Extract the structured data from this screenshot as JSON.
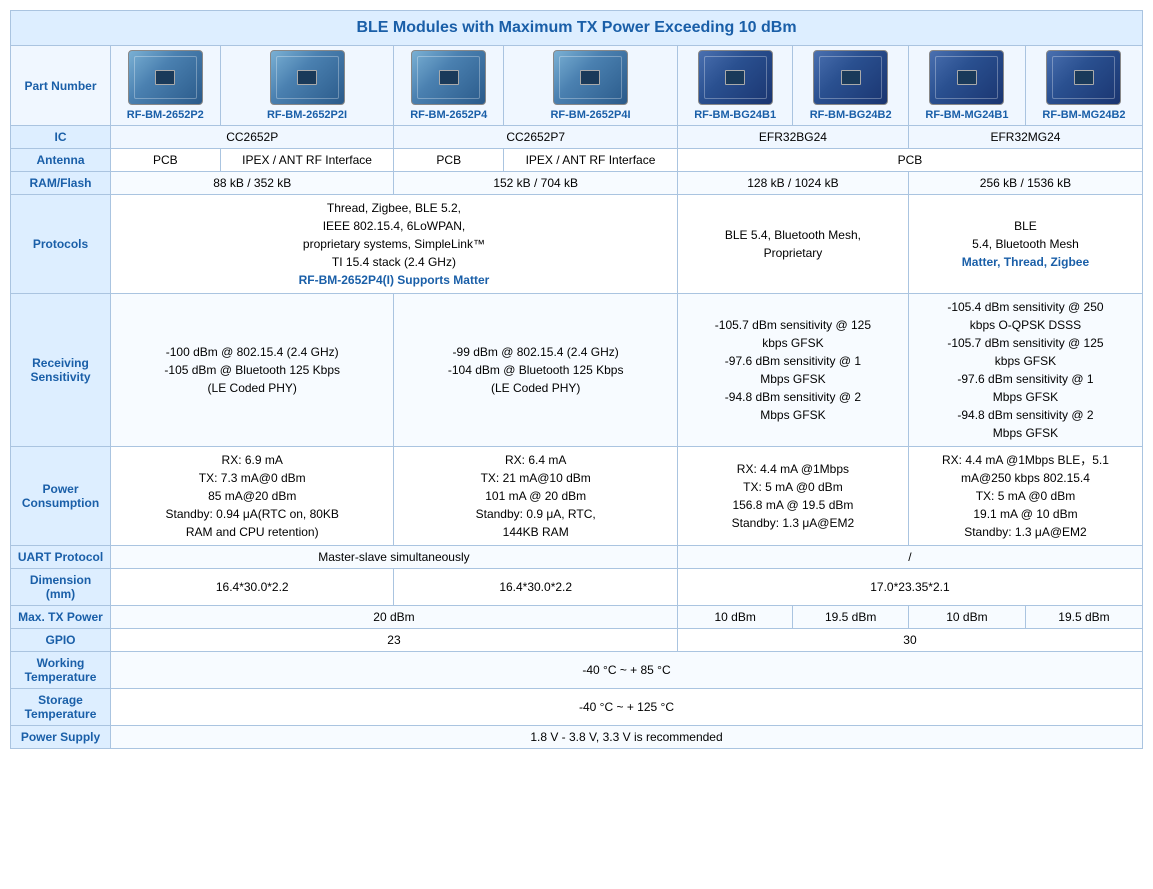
{
  "title": "BLE Modules with Maximum TX Power Exceeding 10 dBm",
  "columns": [
    {
      "id": "col1",
      "part": "RF-BM-2652P2",
      "group": "A"
    },
    {
      "id": "col2",
      "part": "RF-BM-2652P2I",
      "group": "A"
    },
    {
      "id": "col3",
      "part": "RF-BM-2652P4",
      "group": "B"
    },
    {
      "id": "col4",
      "part": "RF-BM-2652P4I",
      "group": "B"
    },
    {
      "id": "col5",
      "part": "RF-BM-BG24B1",
      "group": "C"
    },
    {
      "id": "col6",
      "part": "RF-BM-BG24B2",
      "group": "C"
    },
    {
      "id": "col7",
      "part": "RF-BM-MG24B1",
      "group": "D"
    },
    {
      "id": "col8",
      "part": "RF-BM-MG24B2",
      "group": "D"
    }
  ],
  "rows": {
    "ic": {
      "label": "IC",
      "groupA": "CC2652P",
      "groupB": "CC2652P7",
      "groupC": "EFR32BG24",
      "groupD": "EFR32MG24"
    },
    "antenna": {
      "label": "Antenna",
      "col1": "PCB",
      "col2": "IPEX / ANT RF Interface",
      "col3": "PCB",
      "col4": "IPEX / ANT RF Interface",
      "groupCD": "PCB"
    },
    "ram_flash": {
      "label": "RAM/Flash",
      "groupAB1": "88 kB / 352 kB",
      "groupAB2": "152 kB / 704 kB",
      "groupC": "128 kB / 1024 kB",
      "groupD": "256 kB / 1536 kB"
    },
    "protocols": {
      "label": "Protocols",
      "groupAB": "Thread, Zigbee, BLE 5.2,\nIEEE 802.15.4, 6LoWPAN,\nproprietary systems, SimpleLink™\nTI 15.4 stack (2.4 GHz)",
      "groupAB_bold": "RF-BM-2652P4(I) Supports Matter",
      "groupC": "BLE 5.4, Bluetooth Mesh,\nPropriety",
      "groupD_line1": "BLE",
      "groupD_line2": "5.4, Bluetooth Mesh",
      "groupD_bold": "Matter, Thread, Zigbee"
    },
    "rx_sensitivity": {
      "label": "Receiving\nSensitivity",
      "groupAB1": "-100 dBm @ 802.15.4 (2.4 GHz)\n-105 dBm @ Bluetooth 125 Kbps\n(LE Coded PHY)",
      "groupAB2": "-99 dBm @ 802.15.4 (2.4 GHz)\n-104 dBm @ Bluetooth 125 Kbps\n(LE Coded PHY)",
      "groupC": "-105.7 dBm sensitivity @ 125 kbps GFSK\n-97.6 dBm sensitivity @ 1 Mbps GFSK\n-94.8 dBm sensitivity @ 2 Mbps GFSK",
      "groupD": "-105.4 dBm sensitivity @ 250 kbps O-QPSK DSSS\n-105.7 dBm sensitivity @ 125 kbps GFSK\n-97.6 dBm sensitivity @ 1 Mbps GFSK\n-94.8 dBm sensitivity @ 2 Mbps GFSK"
    },
    "power_consumption": {
      "label": "Power\nConsumption",
      "groupAB1": "RX: 6.9 mA\nTX: 7.3 mA@0 dBm\n85 mA@20 dBm\nStandby: 0.94 μA(RTC on, 80KB\nRAM and CPU retention)",
      "groupAB2": "RX: 6.4 mA\nTX: 21 mA@10 dBm\n101 mA @ 20 dBm\nStandby: 0.9 μA,  RTC,\n144KB RAM",
      "groupC": "RX: 4.4 mA @1Mbps\nTX: 5 mA @0 dBm\n156.8 mA @ 19.5 dBm\nStandby: 1.3 μA@EM2",
      "groupD": "RX: 4.4 mA @1Mbps BLE，5.1 mA@250 kbps 802.15.4\nTX: 5 mA @0 dBm\n19.1 mA @ 10 dBm\nStandby: 1.3 μA@EM2"
    },
    "uart": {
      "label": "UART Protocol",
      "groupAB": "Master-slave simultaneously",
      "groupBCCD": "/"
    },
    "dimension": {
      "label": "Dimension (mm)",
      "groupAB": "16.4*30.0*2.2",
      "groupAB2": "16.4*30.0*2.2",
      "groupCD": "17.0*23.35*2.1"
    },
    "max_tx": {
      "label": "Max. TX Power",
      "groupAB": "20 dBm",
      "col5": "10 dBm",
      "col6": "19.5 dBm",
      "col7": "10 dBm",
      "col8": "19.5 dBm"
    },
    "gpio": {
      "label": "GPIO",
      "groupAB": "23",
      "groupCD": "30"
    },
    "working_temp": {
      "label": "Working\nTemperature",
      "value": "-40 °C ~ + 85 °C"
    },
    "storage_temp": {
      "label": "Storage\nTemperature",
      "value": "-40 °C ~ + 125 °C"
    },
    "power_supply": {
      "label": "Power Supply",
      "value": "1.8 V - 3.8 V,  3.3 V is recommended"
    }
  }
}
